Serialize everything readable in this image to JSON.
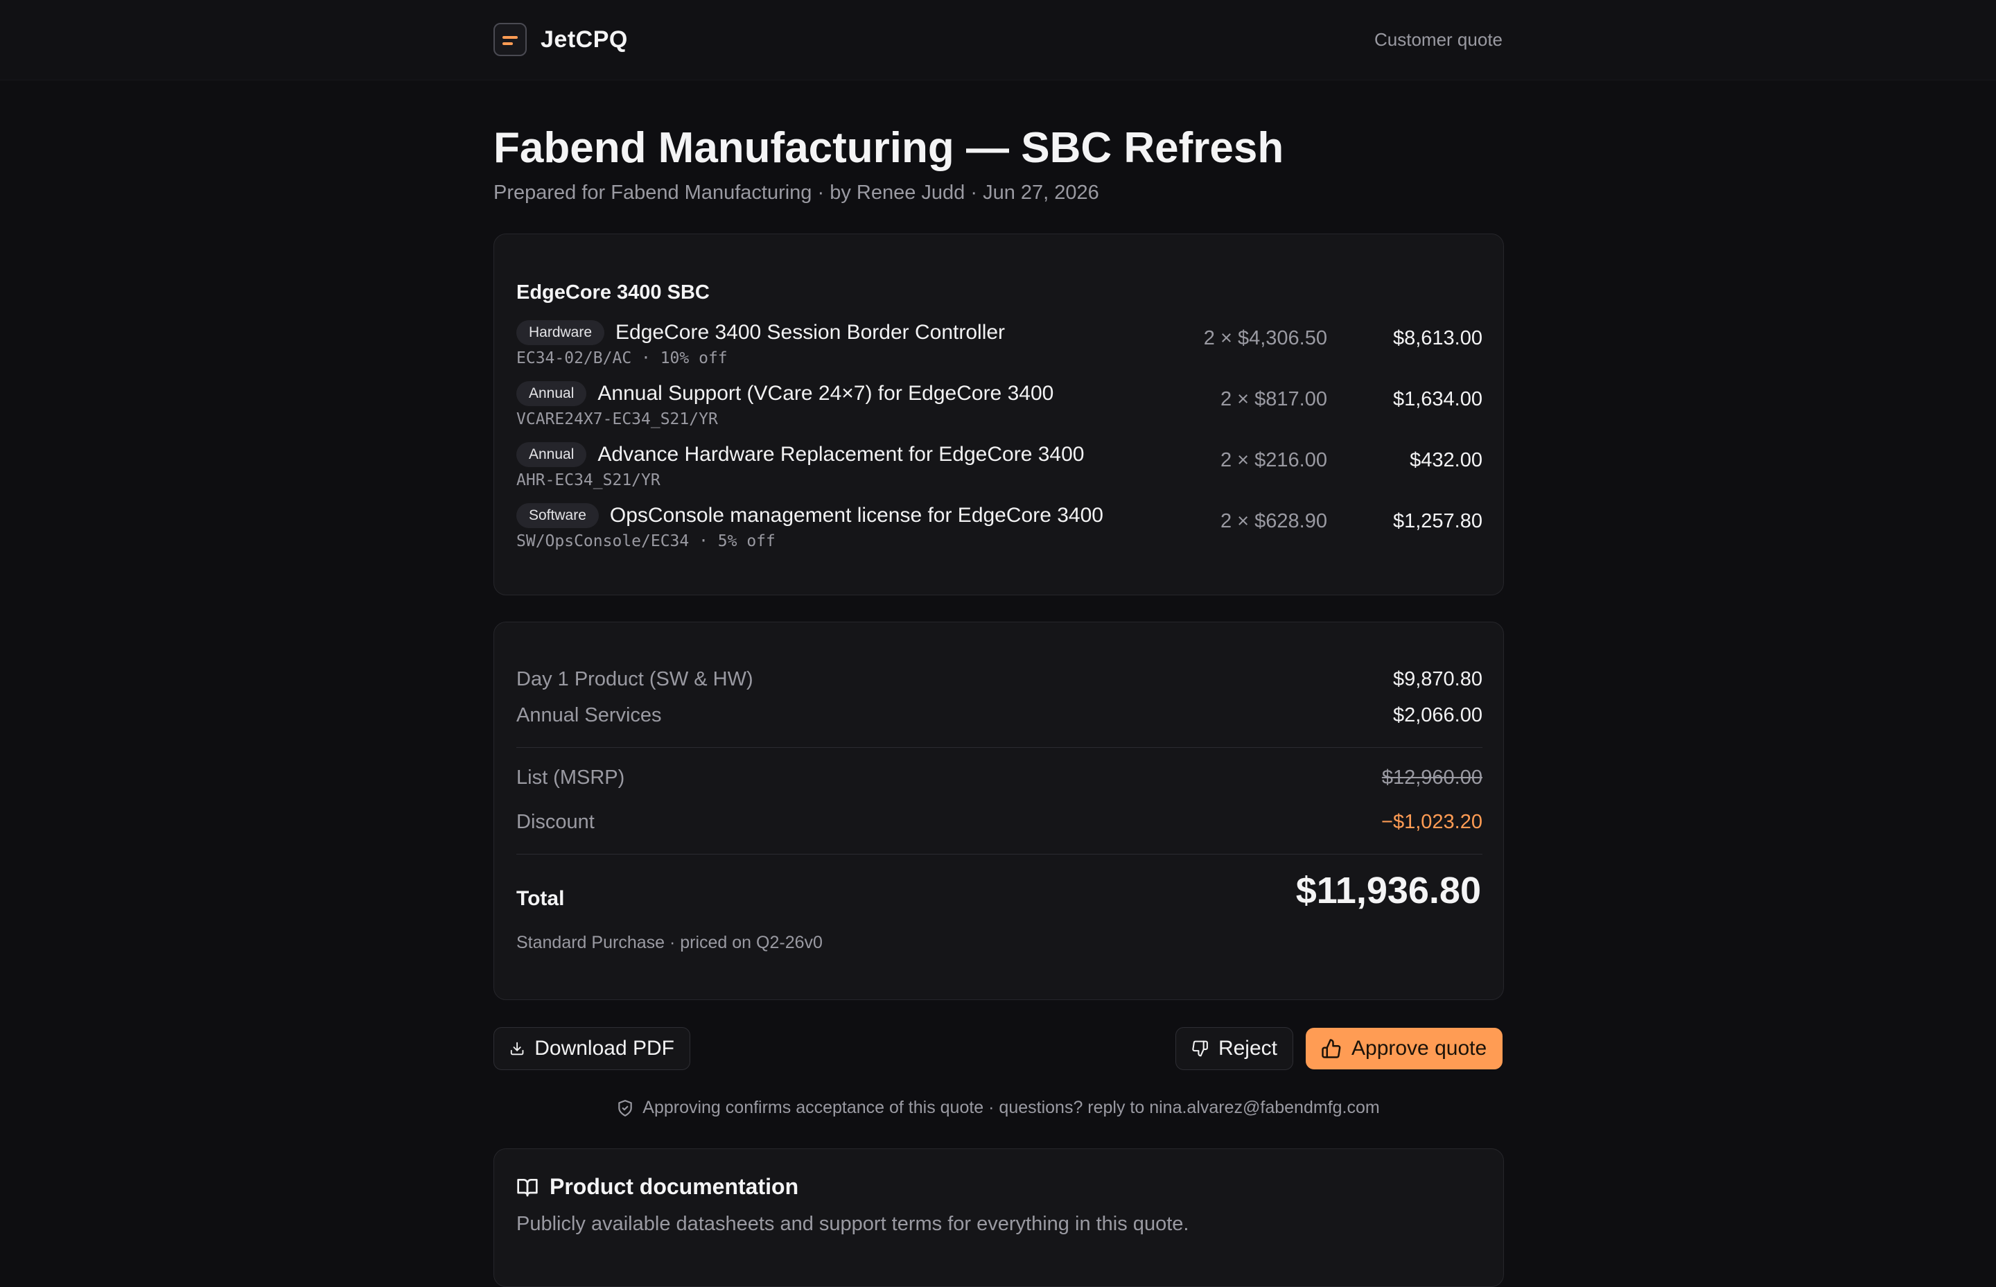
{
  "app": {
    "name": "JetCPQ",
    "top_link": "Customer quote"
  },
  "quote": {
    "title": "Fabend Manufacturing — SBC Refresh",
    "subtitle": "Prepared for Fabend Manufacturing · by Renee Judd · Jun 27, 2026"
  },
  "items_section": {
    "title": "EdgeCore 3400 SBC",
    "items": [
      {
        "badge": "Hardware",
        "name": "EdgeCore 3400 Session Border Controller",
        "sku": "EC34-02/B/AC · 10% off",
        "qty_price": "2 × $4,306.50",
        "total": "$8,613.00"
      },
      {
        "badge": "Annual",
        "name": "Annual Support (VCare 24×7) for EdgeCore 3400",
        "sku": "VCARE24X7-EC34_S21/YR",
        "qty_price": "2 × $817.00",
        "total": "$1,634.00"
      },
      {
        "badge": "Annual",
        "name": "Advance Hardware Replacement for EdgeCore 3400",
        "sku": "AHR-EC34_S21/YR",
        "qty_price": "2 × $216.00",
        "total": "$432.00"
      },
      {
        "badge": "Software",
        "name": "OpsConsole management license for EdgeCore 3400",
        "sku": "SW/OpsConsole/EC34 · 5% off",
        "qty_price": "2 × $628.90",
        "total": "$1,257.80"
      }
    ]
  },
  "summary": {
    "day1_label": "Day 1 Product (SW & HW)",
    "day1_value": "$9,870.80",
    "annual_label": "Annual Services",
    "annual_value": "$2,066.00",
    "list_label": "List (MSRP)",
    "list_value": "$12,960.00",
    "discount_label": "Discount",
    "discount_value": "−$1,023.20",
    "total_label": "Total",
    "total_value": "$11,936.80",
    "pricing_note": "Standard Purchase · priced on Q2-26v0"
  },
  "actions": {
    "download_label": "Download PDF",
    "reject_label": "Reject",
    "approve_label": "Approve quote",
    "confirm_note": "Approving confirms acceptance of this quote · questions? reply to nina.alvarez@fabendmfg.com"
  },
  "docs": {
    "title": "Product documentation",
    "description": "Publicly available datasheets and support terms for everything in this quote."
  },
  "colors": {
    "accent": "#ff9c54",
    "background": "#0e0e11",
    "card": "#151518"
  },
  "icons": [
    "brand-logo-icon",
    "download-icon",
    "thumbs-down-icon",
    "thumbs-up-icon",
    "shield-check-icon",
    "book-open-icon"
  ]
}
